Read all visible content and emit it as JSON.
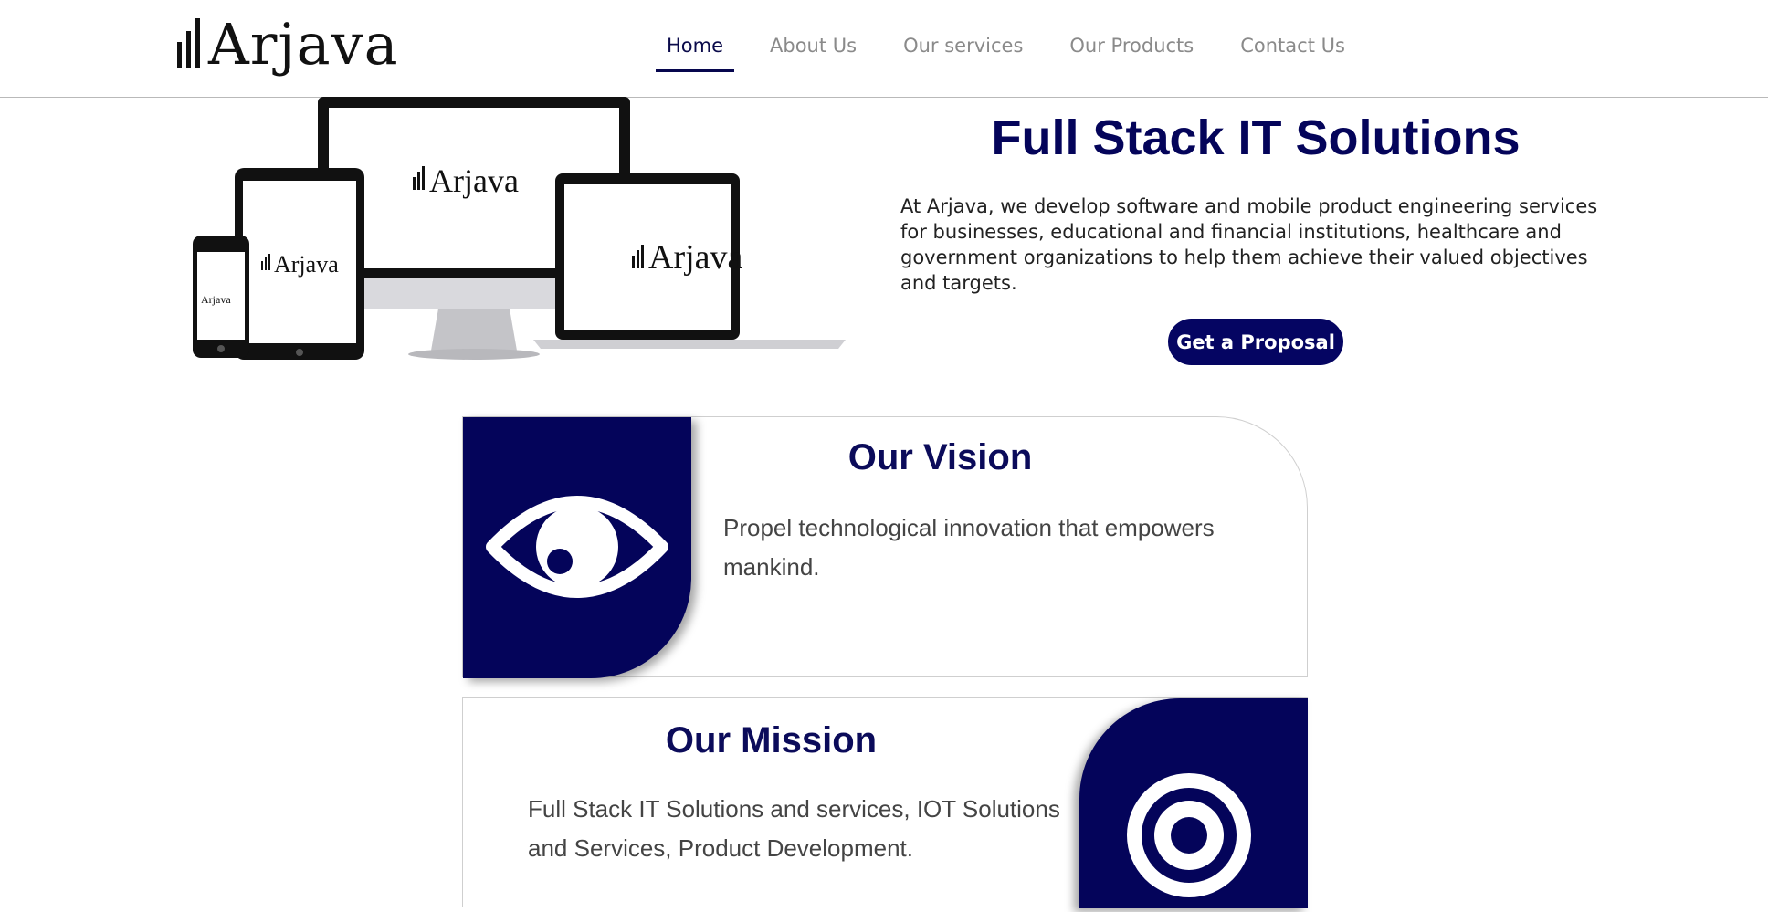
{
  "brand": {
    "name": "Arjava",
    "accent": "#04045a"
  },
  "nav": {
    "items": [
      {
        "label": "Home",
        "active": true
      },
      {
        "label": "About Us",
        "active": false
      },
      {
        "label": "Our services",
        "active": false
      },
      {
        "label": "Our Products",
        "active": false
      },
      {
        "label": "Contact Us",
        "active": false
      }
    ]
  },
  "hero": {
    "title": "Full Stack IT Solutions",
    "description": "At Arjava, we develop software and mobile product engineering services for businesses, educational and financial institutions, healthcare and government organizations to help them achieve their valued objectives and targets.",
    "cta_label": "Get a Proposal",
    "device_logo_text": "Arjava"
  },
  "vision": {
    "title": "Our Vision",
    "text": "Propel technological innovation that empowers mankind.",
    "icon": "eye-icon"
  },
  "mission": {
    "title": "Our Mission",
    "text": "Full Stack IT Solutions and services, IOT Solutions and Services, Product Development.",
    "icon": "target-icon"
  }
}
